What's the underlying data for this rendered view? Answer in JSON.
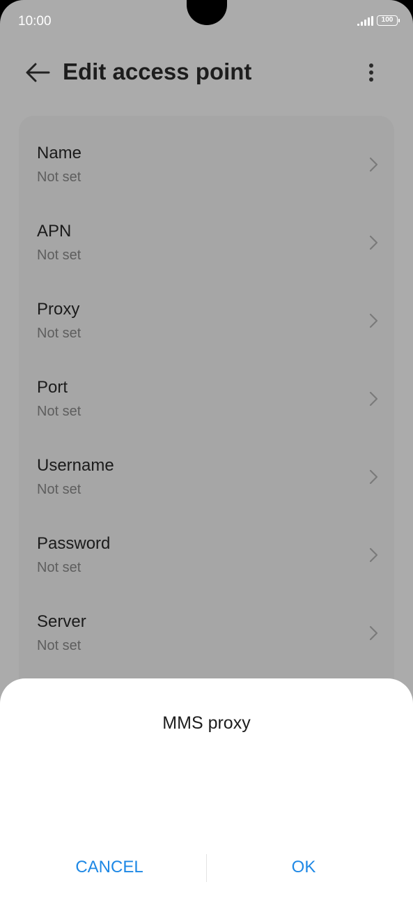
{
  "status_bar": {
    "time": "10:00",
    "battery": "100"
  },
  "header": {
    "title": "Edit access point",
    "back_icon": "arrow-left-icon",
    "more_icon": "more-vertical-icon"
  },
  "settings": [
    {
      "title": "Name",
      "value": "Not set"
    },
    {
      "title": "APN",
      "value": "Not set"
    },
    {
      "title": "Proxy",
      "value": "Not set"
    },
    {
      "title": "Port",
      "value": "Not set"
    },
    {
      "title": "Username",
      "value": "Not set"
    },
    {
      "title": "Password",
      "value": "Not set"
    },
    {
      "title": "Server",
      "value": "Not set"
    }
  ],
  "dialog": {
    "title": "MMS proxy",
    "cancel_label": "CANCEL",
    "ok_label": "OK",
    "accent_color": "#1e88e5"
  }
}
